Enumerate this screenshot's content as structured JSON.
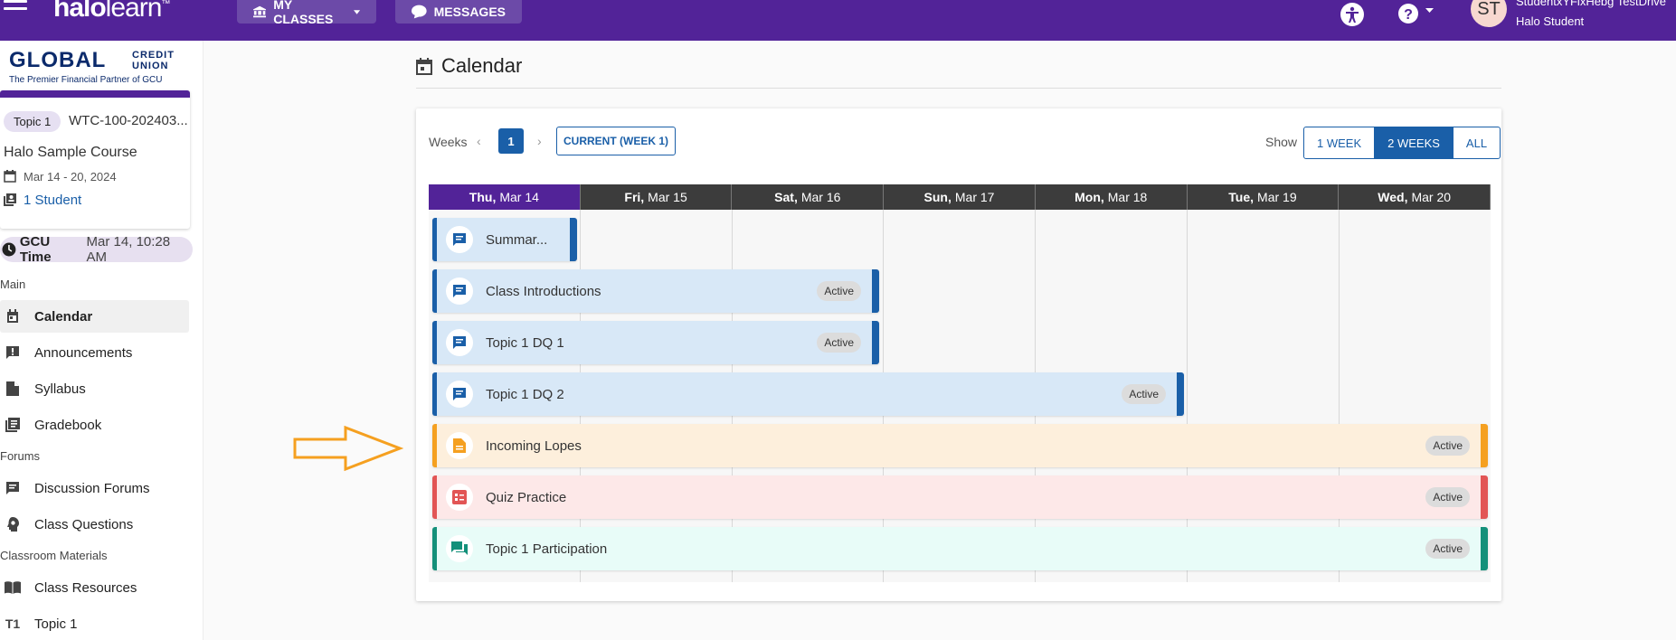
{
  "header": {
    "logo_bold": "halo",
    "logo_light": "learn",
    "logo_tm": "™",
    "my_classes": "MY CLASSES",
    "messages": "MESSAGES",
    "avatar_initials": "ST",
    "user_name": "StudentxYFixHebg TestDrive",
    "user_role": "Halo Student"
  },
  "sidebar": {
    "gcu_logo_main": "GLOBAL",
    "gcu_logo_cu": "CREDIT UNION",
    "gcu_logo_tag": "The Premier Financial Partner of GCU",
    "topic_pill": "Topic 1",
    "course_code": "WTC-100-202403...",
    "course_name": "Halo Sample Course",
    "course_dates": "Mar 14 - 20, 2024",
    "course_students": "1 Student",
    "gcu_time_label": "GCU Time",
    "gcu_time_value": "Mar 14, 10:28 AM",
    "section_main": "Main",
    "section_forums": "Forums",
    "section_materials": "Classroom Materials",
    "items": [
      {
        "label": "Calendar"
      },
      {
        "label": "Announcements"
      },
      {
        "label": "Syllabus"
      },
      {
        "label": "Gradebook"
      },
      {
        "label": "Discussion Forums"
      },
      {
        "label": "Class Questions"
      },
      {
        "label": "Class Resources"
      },
      {
        "label": "Topic 1",
        "prefix": "T1"
      }
    ]
  },
  "main": {
    "title": "Calendar",
    "weeks_label": "Weeks",
    "week_number": "1",
    "current_week": "CURRENT (WEEK 1)",
    "show_label": "Show",
    "range_options": [
      "1 WEEK",
      "2 WEEKS",
      "ALL"
    ],
    "selected_range": "2 WEEKS",
    "days": [
      {
        "dow": "Thu,",
        "date": "Mar 14"
      },
      {
        "dow": "Fri,",
        "date": "Mar 15"
      },
      {
        "dow": "Sat,",
        "date": "Mar 16"
      },
      {
        "dow": "Sun,",
        "date": "Mar 17"
      },
      {
        "dow": "Mon,",
        "date": "Mar 18"
      },
      {
        "dow": "Tue,",
        "date": "Mar 19"
      },
      {
        "dow": "Wed,",
        "date": "Mar 20"
      }
    ],
    "events": [
      {
        "title": "Summar...",
        "badge": "",
        "type": "discussion",
        "color": "#1a5fa8"
      },
      {
        "title": "Class Introductions",
        "badge": "Active",
        "type": "discussion",
        "color": "#1a5fa8"
      },
      {
        "title": "Topic 1 DQ 1",
        "badge": "Active",
        "type": "discussion",
        "color": "#1a5fa8"
      },
      {
        "title": "Topic 1 DQ 2",
        "badge": "Active",
        "type": "discussion",
        "color": "#1a5fa8"
      },
      {
        "title": "Incoming Lopes",
        "badge": "Active",
        "type": "document",
        "color": "#f5a020"
      },
      {
        "title": "Quiz Practice",
        "badge": "Active",
        "type": "quiz",
        "color": "#e25555"
      },
      {
        "title": "Topic 1 Participation",
        "badge": "Active",
        "type": "participation",
        "color": "#14907a"
      }
    ]
  },
  "annotation": {
    "color": "#f5a020"
  }
}
